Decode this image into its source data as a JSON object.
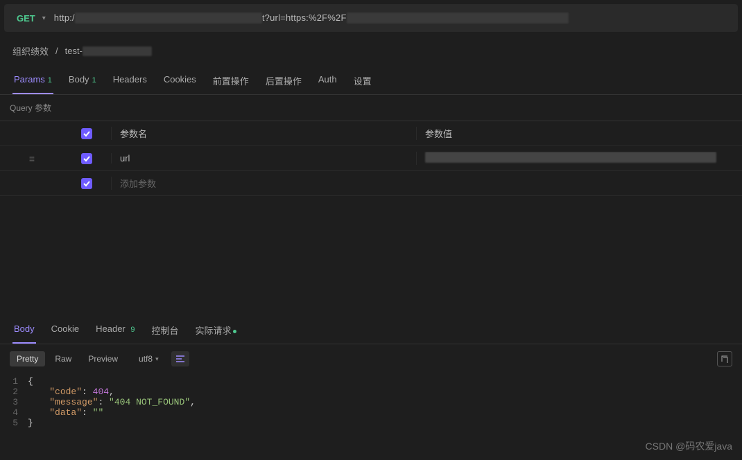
{
  "url_bar": {
    "method": "GET",
    "url_prefix": "http:/",
    "url_mid": "t?url=https:%2F%2F"
  },
  "breadcrumb": {
    "item1": "组织绩效",
    "sep": "/",
    "item2": "test-"
  },
  "req_tabs": [
    {
      "label": "Params",
      "badge": "1",
      "active": true
    },
    {
      "label": "Body",
      "badge": "1"
    },
    {
      "label": "Headers"
    },
    {
      "label": "Cookies"
    },
    {
      "label": "前置操作"
    },
    {
      "label": "后置操作"
    },
    {
      "label": "Auth"
    },
    {
      "label": "设置"
    }
  ],
  "query": {
    "section_title": "Query 参数",
    "headers": {
      "name": "参数名",
      "value": "参数值"
    },
    "rows": [
      {
        "name": "url"
      }
    ],
    "add_placeholder": "添加参数"
  },
  "resp_tabs": [
    {
      "label": "Body",
      "active": true
    },
    {
      "label": "Cookie"
    },
    {
      "label": "Header",
      "badge": "9"
    },
    {
      "label": "控制台"
    },
    {
      "label": "实际请求",
      "dot": true
    }
  ],
  "view_modes": {
    "pretty": "Pretty",
    "raw": "Raw",
    "preview": "Preview",
    "encoding": "utf8"
  },
  "response_json": {
    "code": 404,
    "message": "404 NOT_FOUND",
    "data": ""
  },
  "watermark": "CSDN @码农爱java"
}
